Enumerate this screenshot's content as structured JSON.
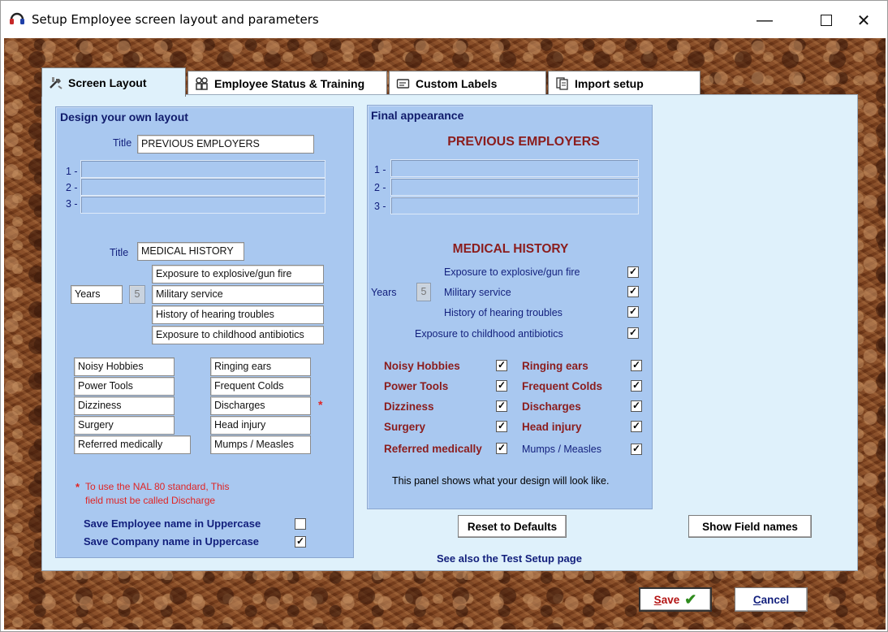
{
  "window": {
    "title": "Setup Employee screen layout and parameters",
    "minimize": "—",
    "close": "✕"
  },
  "tabs": [
    {
      "label": "Screen Layout",
      "icon": "tools-icon",
      "active": true
    },
    {
      "label": "Employee Status & Training",
      "icon": "people-icon",
      "active": false
    },
    {
      "label": "Custom Labels",
      "icon": "label-icon",
      "active": false
    },
    {
      "label": "Import setup",
      "icon": "document-icon",
      "active": false
    }
  ],
  "design": {
    "heading": "Design your own layout",
    "title_label": "Title",
    "title_value": "PREVIOUS EMPLOYERS",
    "rows": [
      "1 -",
      "2 -",
      "3 -"
    ],
    "medical_title_label": "Title",
    "medical_title_value": "MEDICAL HISTORY",
    "years_value": "Years",
    "years_number": "5",
    "history_items": [
      "Exposure to explosive/gun fire",
      "Military service",
      "History of hearing troubles",
      "Exposure to childhood antibiotics"
    ],
    "left_fields": [
      "Noisy Hobbies",
      "Power Tools",
      "Dizziness",
      "Surgery",
      "Referred medically"
    ],
    "right_fields": [
      "Ringing ears",
      "Frequent Colds",
      "Discharges",
      "Head injury",
      "Mumps / Measles"
    ],
    "asterisk": "*",
    "note_asterisk": "*",
    "note_line1": "To use the NAL 80 standard,  This",
    "note_line2": "field must be called Discharge",
    "save_employee_upper": "Save Employee name in Uppercase",
    "save_company_upper": "Save Company name in Uppercase",
    "save_employee_checked": "",
    "save_company_checked": "✓"
  },
  "preview": {
    "heading": "Final appearance",
    "title": "PREVIOUS EMPLOYERS",
    "rows": [
      "1 -",
      "2 -",
      "3 -"
    ],
    "medical_title": "MEDICAL HISTORY",
    "years": "Years",
    "years_number": "5",
    "history_items": [
      "Exposure to explosive/gun fire",
      "Military service",
      "History of hearing troubles",
      "Exposure to childhood antibiotics"
    ],
    "left_fields": [
      "Noisy Hobbies",
      "Power Tools",
      "Dizziness",
      "Surgery",
      "Referred medically"
    ],
    "right_fields": [
      "Ringing ears",
      "Frequent Colds",
      "Discharges",
      "Head injury",
      "Mumps / Measles"
    ],
    "check": "✓",
    "footer": "This panel shows what your design will look like."
  },
  "buttons": {
    "reset": "Reset to Defaults",
    "show_fields": "Show Field names",
    "see_also": "See also the Test Setup page",
    "save_first": "S",
    "save_rest": "ave",
    "save_check": "✔",
    "cancel_first": "C",
    "cancel_rest": "ancel"
  }
}
